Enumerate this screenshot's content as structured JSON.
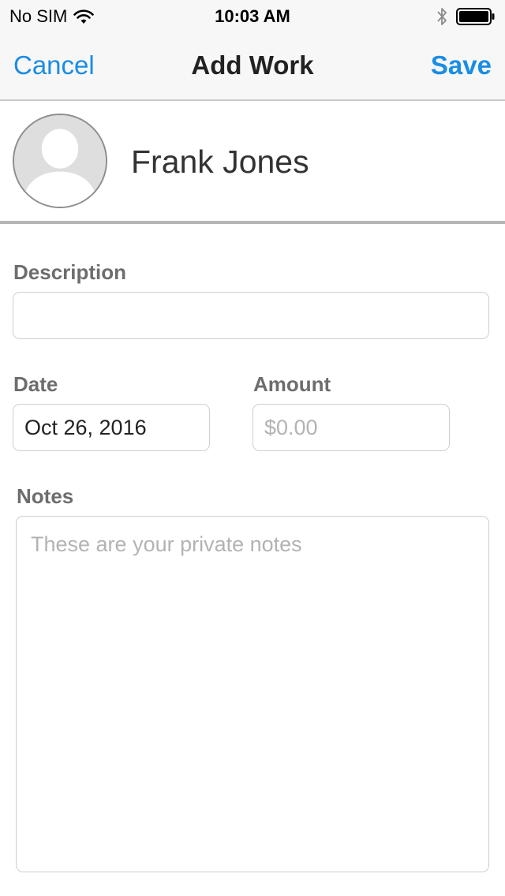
{
  "status_bar": {
    "carrier": "No SIM",
    "time": "10:03 AM",
    "icons": [
      "wifi-icon",
      "bluetooth-icon",
      "battery-icon"
    ]
  },
  "nav": {
    "cancel_label": "Cancel",
    "title": "Add Work",
    "save_label": "Save"
  },
  "contact": {
    "name": "Frank Jones",
    "avatar_icon": "person-placeholder-icon"
  },
  "form": {
    "description": {
      "label": "Description",
      "value": "",
      "placeholder": ""
    },
    "date": {
      "label": "Date",
      "value": "Oct 26, 2016"
    },
    "amount": {
      "label": "Amount",
      "value": "",
      "placeholder": "$0.00"
    },
    "notes": {
      "label": "Notes",
      "value": "",
      "placeholder": "These are your private notes"
    }
  },
  "colors": {
    "accent": "#1a8de5",
    "label": "#6d6d6d",
    "bar_background": "#f7f7f7"
  }
}
